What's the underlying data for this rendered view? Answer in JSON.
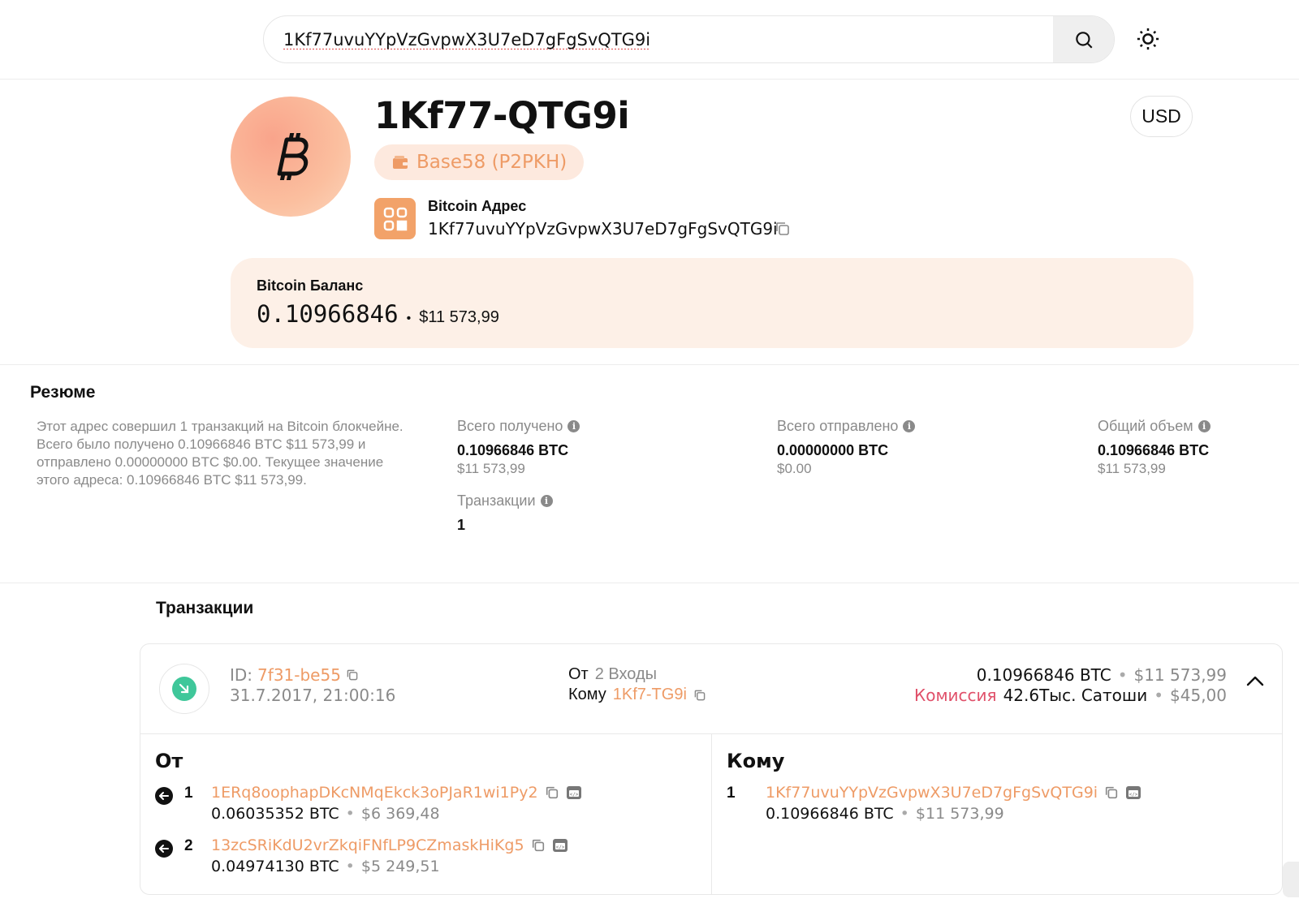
{
  "search": {
    "query": "1Kf77uvuYYpVzGvpwX3U7eD7gFgSvQTG9i"
  },
  "header": {
    "title": "1Kf77-QTG9i",
    "currency": "USD",
    "address_type": "Base58 (P2PKH)",
    "address_label": "Bitcoin Адрес",
    "address": "1Kf77uvuYYpVzGvpwX3U7eD7gFgSvQTG9i"
  },
  "balance": {
    "label": "Bitcoin Баланс",
    "btc": "0.10966846",
    "usd": "$11 573,99"
  },
  "summary": {
    "title": "Резюме",
    "text": "Этот адрес совершил 1 транзакций на Bitcoin блокчейне. Всего было получено 0.10966846 BTC $11 573,99 и отправлено 0.00000000 BTC $0.00. Текущее значение этого адреса: 0.10966846 BTC $11 573,99.",
    "received": {
      "label": "Всего получено",
      "btc": "0.10966846 BTC",
      "usd": "$11 573,99"
    },
    "sent": {
      "label": "Всего отправлено",
      "btc": "0.00000000 BTC",
      "usd": "$0.00"
    },
    "volume": {
      "label": "Общий объем",
      "btc": "0.10966846 BTC",
      "usd": "$11 573,99"
    },
    "transactions": {
      "label": "Транзакции",
      "value": "1"
    }
  },
  "transactions": {
    "title": "Транзакции",
    "items": [
      {
        "id_label": "ID:",
        "id": "7f31-be55",
        "date": "31.7.2017, 21:00:16",
        "from_label": "От",
        "from_value": "2 Входы",
        "to_label": "Кому",
        "to_value": "1Kf7-TG9i",
        "amount_btc": "0.10966846 BTC",
        "amount_usd": "$11 573,99",
        "fee_label": "Комиссия",
        "fee_value": "42.6Тыс. Сатоши",
        "fee_usd": "$45,00",
        "inputs_title": "От",
        "inputs": [
          {
            "index": "1",
            "address": "1ERq8oophapDKcNMqEkck3oPJaR1wi1Py2",
            "btc": "0.06035352 BTC",
            "usd": "$6 369,48"
          },
          {
            "index": "2",
            "address": "13zcSRiKdU2vrZkqiFNfLP9CZmaskHiKg5",
            "btc": "0.04974130 BTC",
            "usd": "$5 249,51"
          }
        ],
        "outputs_title": "Кому",
        "outputs": [
          {
            "index": "1",
            "address": "1Kf77uvuYYpVzGvpwX3U7eD7gFgSvQTG9i",
            "btc": "0.10966846 BTC",
            "usd": "$11 573,99"
          }
        ]
      }
    ]
  },
  "colors": {
    "accent": "#ee9b66",
    "incoming": "#3fc79a",
    "fee": "#e0506a",
    "balance_bg": "#fdf0e7"
  }
}
